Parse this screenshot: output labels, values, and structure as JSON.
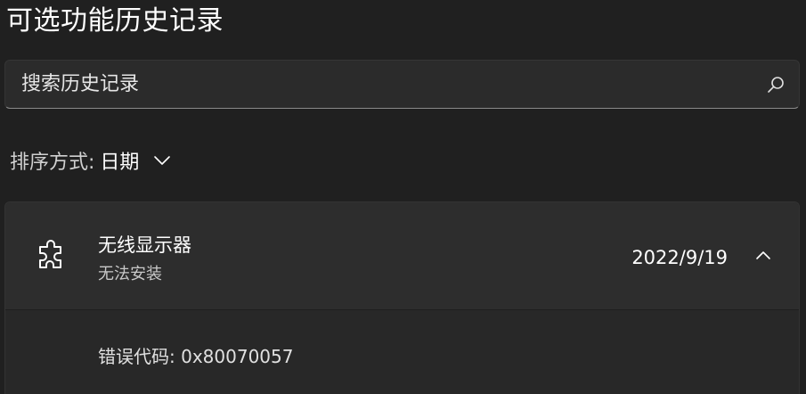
{
  "page": {
    "title": "可选功能历史记录"
  },
  "search": {
    "placeholder": "搜索历史记录",
    "icon": "search-icon"
  },
  "sort": {
    "label": "排序方式:",
    "value": "日期",
    "icon": "chevron-down-icon"
  },
  "history": {
    "items": [
      {
        "name": "无线显示器",
        "status": "无法安装",
        "date": "2022/9/19",
        "icon": "puzzle-icon",
        "expanded": true,
        "error_label": "错误代码:",
        "error_code": "0x80070057"
      }
    ]
  },
  "colors": {
    "background": "#202020",
    "card": "#2b2b2b",
    "text": "#ffffff",
    "secondary_text": "#c8c8c8"
  }
}
